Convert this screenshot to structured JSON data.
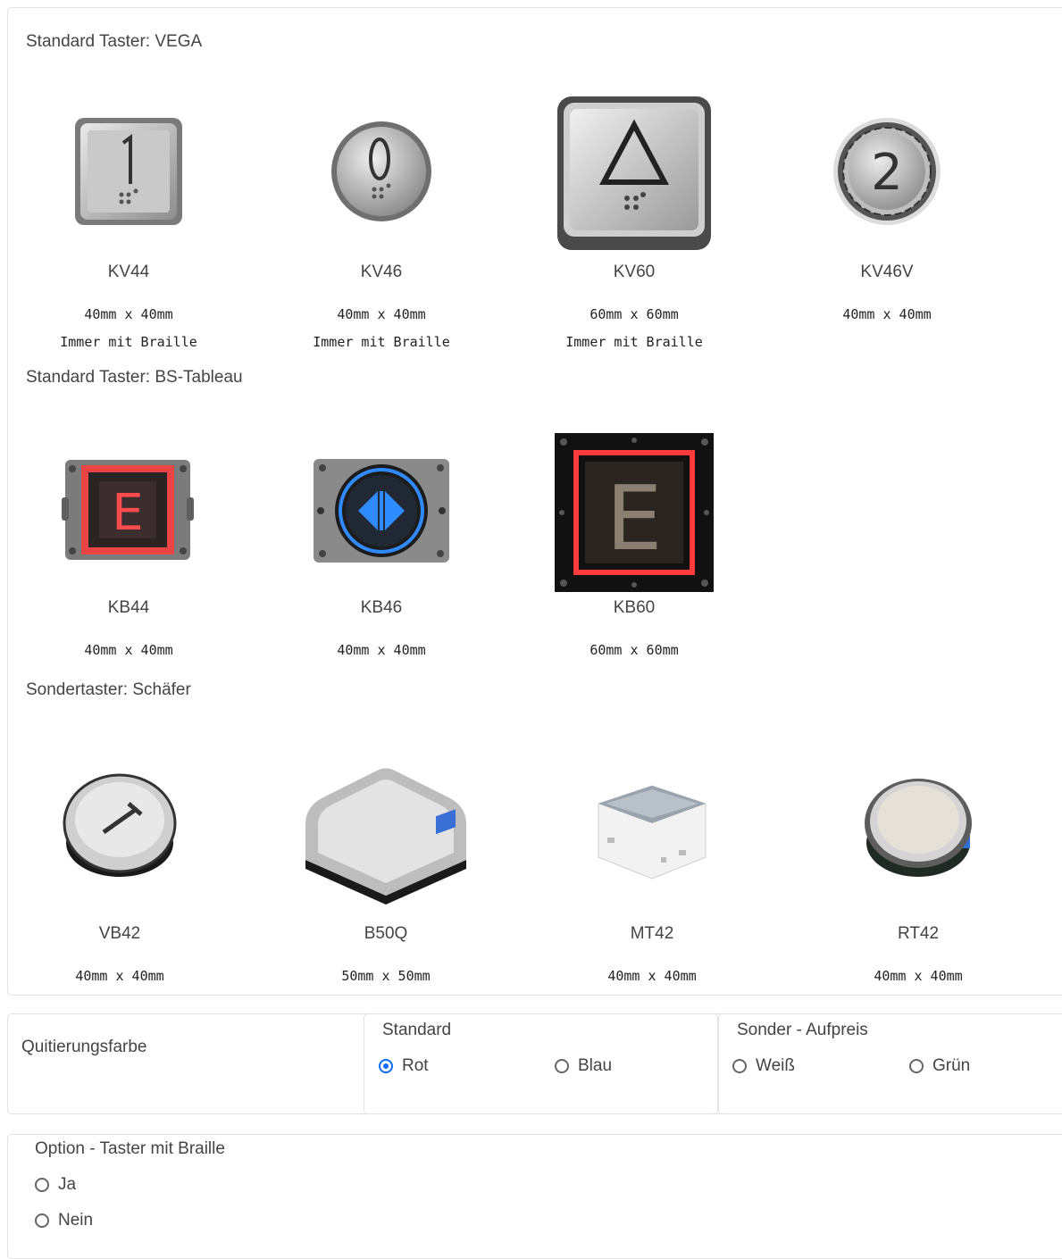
{
  "sections": [
    {
      "title": "Standard Taster: VEGA",
      "products": [
        {
          "name": "KV44",
          "dim": "40mm x 40mm",
          "note": "Immer mit Braille",
          "icon": "square-button-1-braille-icon"
        },
        {
          "name": "KV46",
          "dim": "40mm x 40mm",
          "note": "Immer mit Braille",
          "icon": "round-button-0-braille-icon"
        },
        {
          "name": "KV60",
          "dim": "60mm x 60mm",
          "note": "Immer mit Braille",
          "icon": "square-button-triangle-braille-icon"
        },
        {
          "name": "KV46V",
          "dim": "40mm x 40mm",
          "note": "",
          "icon": "round-button-2-icon"
        }
      ]
    },
    {
      "title": "Standard Taster: BS-Tableau",
      "products": [
        {
          "name": "KB44",
          "dim": "40mm x 40mm",
          "icon": "tableau-button-e-red-icon"
        },
        {
          "name": "KB46",
          "dim": "40mm x 40mm",
          "icon": "tableau-button-door-blue-icon"
        },
        {
          "name": "KB60",
          "dim": "60mm x 60mm",
          "icon": "tableau-button-e-large-icon"
        }
      ]
    },
    {
      "title": "Sondertaster: Schäfer",
      "products": [
        {
          "name": "VB42",
          "dim": "40mm x 40mm",
          "icon": "round-button-1-black-ring-icon"
        },
        {
          "name": "B50Q",
          "dim": "50mm x 50mm",
          "icon": "square-flat-button-icon"
        },
        {
          "name": "MT42",
          "dim": "40mm x 40mm",
          "icon": "cube-button-icon"
        },
        {
          "name": "RT42",
          "dim": "40mm x 40mm",
          "icon": "round-flat-button-icon"
        }
      ]
    }
  ],
  "color": {
    "label": "Quitierungsfarbe",
    "standard": {
      "title": "Standard",
      "options": [
        "Rot",
        "Blau"
      ],
      "selected": "Rot"
    },
    "special": {
      "title": "Sonder - Aufpreis",
      "options": [
        "Weiß",
        "Grün"
      ],
      "selected": ""
    }
  },
  "braille": {
    "title": "Option - Taster mit Braille",
    "options": [
      "Ja",
      "Nein"
    ]
  },
  "colors": {
    "accent": "#0d6efd",
    "tableau_red": "#ff3b3b",
    "tableau_blue": "#2f8bff"
  }
}
